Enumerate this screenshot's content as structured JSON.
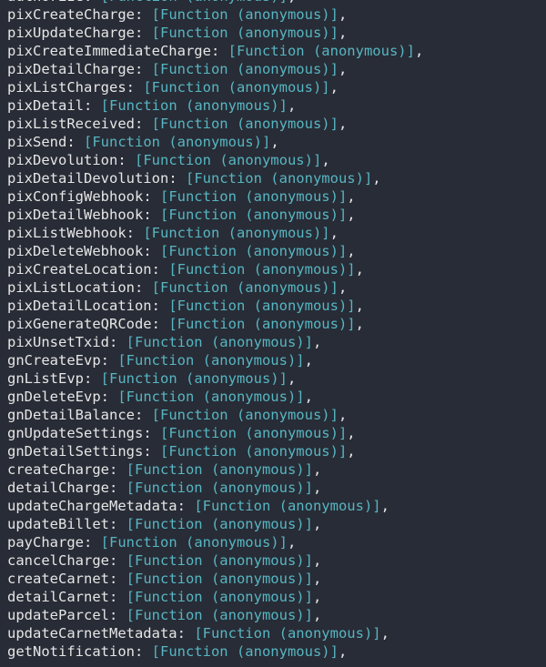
{
  "console": {
    "background_color": "#282c36",
    "key_color": "#e6e6e6",
    "punctuation_color": "#e6e6e6",
    "function_value_color": "#56b6c2",
    "value_text": "[Function (anonymous)]",
    "separator": ": ",
    "trailing_comma": ",",
    "lines": [
      {
        "key": "authorize",
        "value": "[Function (anonymous)]",
        "comma": ","
      },
      {
        "key": "pixCreateCharge",
        "value": "[Function (anonymous)]",
        "comma": ","
      },
      {
        "key": "pixUpdateCharge",
        "value": "[Function (anonymous)]",
        "comma": ","
      },
      {
        "key": "pixCreateImmediateCharge",
        "value": "[Function (anonymous)]",
        "comma": ","
      },
      {
        "key": "pixDetailCharge",
        "value": "[Function (anonymous)]",
        "comma": ","
      },
      {
        "key": "pixListCharges",
        "value": "[Function (anonymous)]",
        "comma": ","
      },
      {
        "key": "pixDetail",
        "value": "[Function (anonymous)]",
        "comma": ","
      },
      {
        "key": "pixListReceived",
        "value": "[Function (anonymous)]",
        "comma": ","
      },
      {
        "key": "pixSend",
        "value": "[Function (anonymous)]",
        "comma": ","
      },
      {
        "key": "pixDevolution",
        "value": "[Function (anonymous)]",
        "comma": ","
      },
      {
        "key": "pixDetailDevolution",
        "value": "[Function (anonymous)]",
        "comma": ","
      },
      {
        "key": "pixConfigWebhook",
        "value": "[Function (anonymous)]",
        "comma": ","
      },
      {
        "key": "pixDetailWebhook",
        "value": "[Function (anonymous)]",
        "comma": ","
      },
      {
        "key": "pixListWebhook",
        "value": "[Function (anonymous)]",
        "comma": ","
      },
      {
        "key": "pixDeleteWebhook",
        "value": "[Function (anonymous)]",
        "comma": ","
      },
      {
        "key": "pixCreateLocation",
        "value": "[Function (anonymous)]",
        "comma": ","
      },
      {
        "key": "pixListLocation",
        "value": "[Function (anonymous)]",
        "comma": ","
      },
      {
        "key": "pixDetailLocation",
        "value": "[Function (anonymous)]",
        "comma": ","
      },
      {
        "key": "pixGenerateQRCode",
        "value": "[Function (anonymous)]",
        "comma": ","
      },
      {
        "key": "pixUnsetTxid",
        "value": "[Function (anonymous)]",
        "comma": ","
      },
      {
        "key": "gnCreateEvp",
        "value": "[Function (anonymous)]",
        "comma": ","
      },
      {
        "key": "gnListEvp",
        "value": "[Function (anonymous)]",
        "comma": ","
      },
      {
        "key": "gnDeleteEvp",
        "value": "[Function (anonymous)]",
        "comma": ","
      },
      {
        "key": "gnDetailBalance",
        "value": "[Function (anonymous)]",
        "comma": ","
      },
      {
        "key": "gnUpdateSettings",
        "value": "[Function (anonymous)]",
        "comma": ","
      },
      {
        "key": "gnDetailSettings",
        "value": "[Function (anonymous)]",
        "comma": ","
      },
      {
        "key": "createCharge",
        "value": "[Function (anonymous)]",
        "comma": ","
      },
      {
        "key": "detailCharge",
        "value": "[Function (anonymous)]",
        "comma": ","
      },
      {
        "key": "updateChargeMetadata",
        "value": "[Function (anonymous)]",
        "comma": ","
      },
      {
        "key": "updateBillet",
        "value": "[Function (anonymous)]",
        "comma": ","
      },
      {
        "key": "payCharge",
        "value": "[Function (anonymous)]",
        "comma": ","
      },
      {
        "key": "cancelCharge",
        "value": "[Function (anonymous)]",
        "comma": ","
      },
      {
        "key": "createCarnet",
        "value": "[Function (anonymous)]",
        "comma": ","
      },
      {
        "key": "detailCarnet",
        "value": "[Function (anonymous)]",
        "comma": ","
      },
      {
        "key": "updateParcel",
        "value": "[Function (anonymous)]",
        "comma": ","
      },
      {
        "key": "updateCarnetMetadata",
        "value": "[Function (anonymous)]",
        "comma": ","
      },
      {
        "key": "getNotification",
        "value": "[Function (anonymous)]",
        "comma": ","
      }
    ]
  }
}
